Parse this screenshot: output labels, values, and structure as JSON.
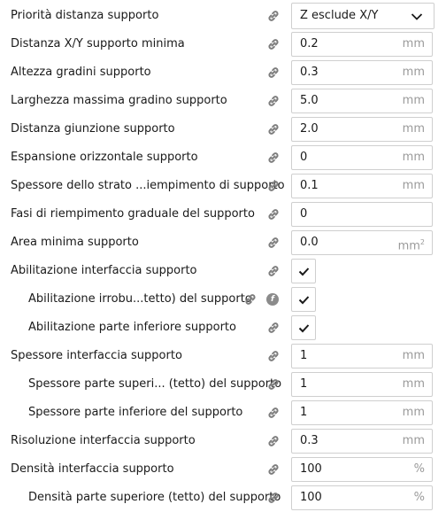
{
  "rows": [
    {
      "label": "Priorità distanza supporto",
      "indent": false,
      "type": "dropdown",
      "value": "Z esclude X/Y",
      "icon": "link-icon"
    },
    {
      "label": "Distanza X/Y supporto minima",
      "indent": false,
      "type": "field",
      "value": "0.2",
      "unit": "mm",
      "icon": "link-icon"
    },
    {
      "label": "Altezza gradini supporto",
      "indent": false,
      "type": "field",
      "value": "0.3",
      "unit": "mm",
      "icon": "link-icon"
    },
    {
      "label": "Larghezza massima gradino supporto",
      "indent": false,
      "type": "field",
      "value": "5.0",
      "unit": "mm",
      "icon": "link-icon"
    },
    {
      "label": "Distanza giunzione supporto",
      "indent": false,
      "type": "field",
      "value": "2.0",
      "unit": "mm",
      "icon": "link-icon"
    },
    {
      "label": "Espansione orizzontale supporto",
      "indent": false,
      "type": "field",
      "value": "0",
      "unit": "mm",
      "icon": "link-icon"
    },
    {
      "label": "Spessore dello strato ...iempimento di supporto",
      "indent": false,
      "type": "field",
      "value": "0.1",
      "unit": "mm",
      "icon": "link-icon"
    },
    {
      "label": "Fasi di riempimento graduale del supporto",
      "indent": false,
      "type": "field",
      "value": "0",
      "unit": "",
      "icon": "link-icon"
    },
    {
      "label": "Area minima supporto",
      "indent": false,
      "type": "field",
      "value": "0.0",
      "unit": "mm",
      "unit_sup": "2",
      "icon": "link-icon"
    },
    {
      "label": "Abilitazione interfaccia supporto",
      "indent": false,
      "type": "check",
      "checked": true,
      "icon": "link-icon"
    },
    {
      "label": "Abilitazione irrobu...tetto) del supporto",
      "indent": true,
      "type": "check",
      "checked": true,
      "icon": "link-icon",
      "extra_icon": "function-icon",
      "extra_text": "f"
    },
    {
      "label": "Abilitazione parte inferiore supporto",
      "indent": true,
      "type": "check",
      "checked": true,
      "icon": "link-icon"
    },
    {
      "label": "Spessore interfaccia supporto",
      "indent": false,
      "type": "field",
      "value": "1",
      "unit": "mm",
      "icon": "link-icon"
    },
    {
      "label": "Spessore parte superi... (tetto) del supporto",
      "indent": true,
      "type": "field",
      "value": "1",
      "unit": "mm",
      "icon": "link-icon"
    },
    {
      "label": "Spessore parte inferiore del supporto",
      "indent": true,
      "type": "field",
      "value": "1",
      "unit": "mm",
      "icon": "link-icon"
    },
    {
      "label": "Risoluzione interfaccia supporto",
      "indent": false,
      "type": "field",
      "value": "0.3",
      "unit": "mm",
      "icon": "link-icon"
    },
    {
      "label": "Densità interfaccia supporto",
      "indent": false,
      "type": "field",
      "value": "100",
      "unit": "%",
      "icon": "link-icon"
    },
    {
      "label": "Densità parte superiore (tetto) del supporto",
      "indent": true,
      "type": "field",
      "value": "100",
      "unit": "%",
      "icon": "link-icon"
    }
  ],
  "colors": {
    "field_border": "#cfcfcf",
    "unit_text": "#9a9a9a",
    "icon_gray": "#8b8b8b",
    "label_text": "#1a1a1a"
  }
}
